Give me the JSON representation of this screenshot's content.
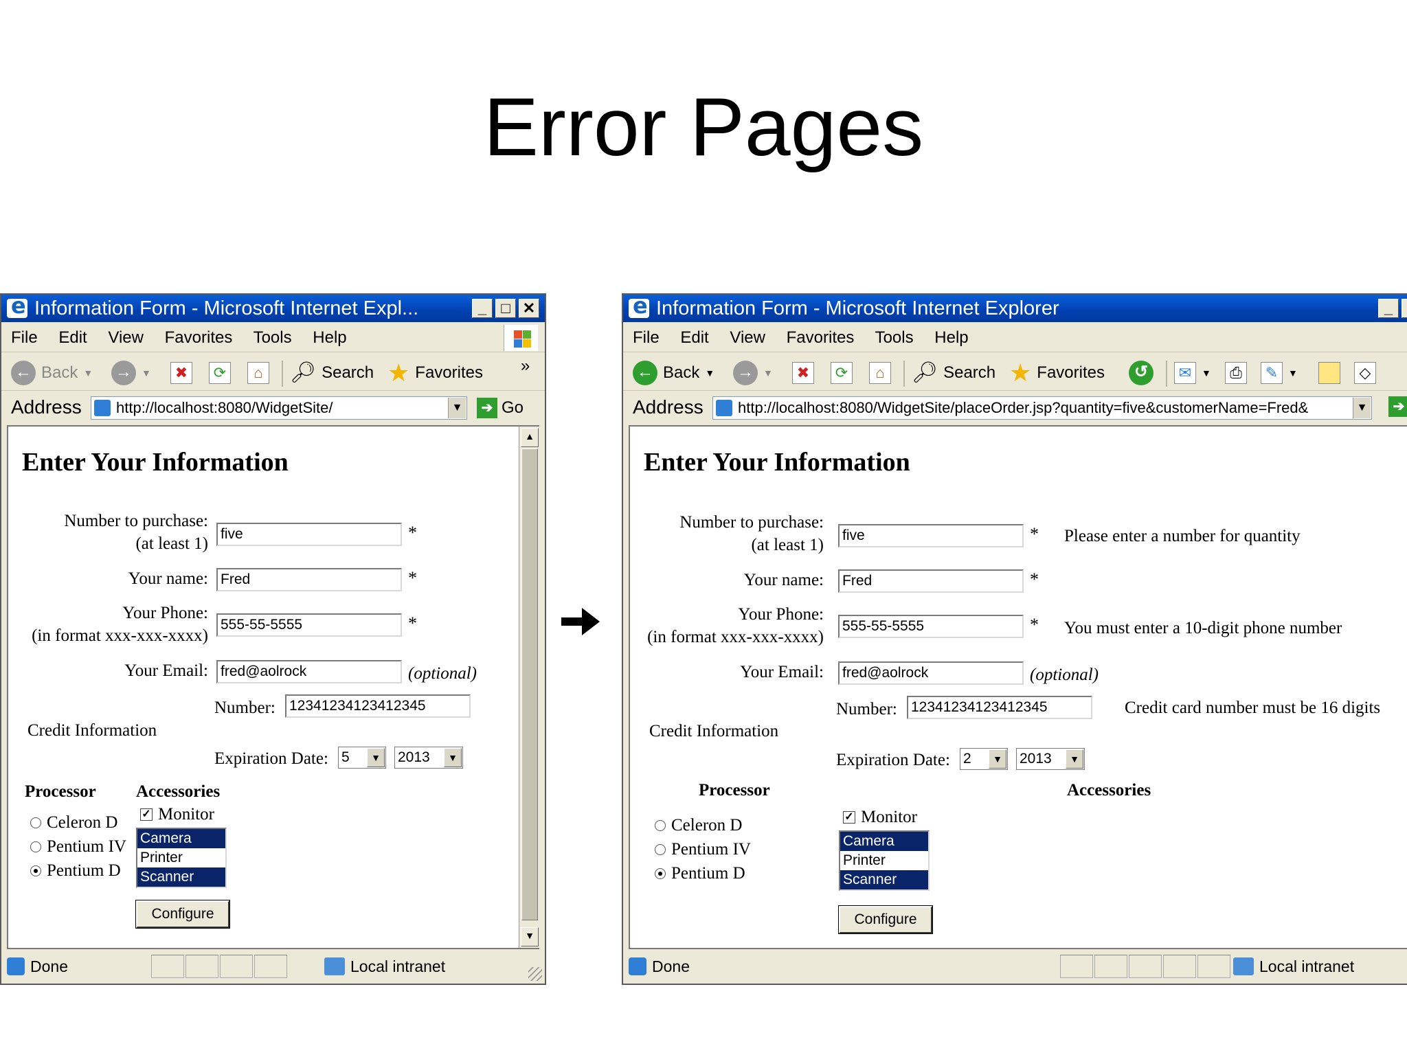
{
  "slide": {
    "title": "Error Pages"
  },
  "left_window": {
    "title": "Information Form - Microsoft Internet Expl...",
    "menu": [
      "File",
      "Edit",
      "View",
      "Favorites",
      "Tools",
      "Help"
    ],
    "toolbar": {
      "back": "Back",
      "search": "Search",
      "favorites": "Favorites",
      "more": "»"
    },
    "address": {
      "label": "Address",
      "url": "http://localhost:8080/WidgetSite/",
      "go": "Go"
    },
    "form": {
      "heading": "Enter Your Information",
      "number_label_1": "Number to purchase:",
      "number_label_2": "(at least 1)",
      "number_value": "five",
      "name_label": "Your name:",
      "name_value": "Fred",
      "phone_label_1": "Your Phone:",
      "phone_label_2": "(in format xxx-xxx-xxxx)",
      "phone_value": "555-55-5555",
      "email_label": "Your Email:",
      "email_value": "fred@aolrock",
      "optional": "(optional)",
      "required_mark": "*",
      "credit_label": "Credit Information",
      "card_number_label": "Number:",
      "card_number_value": "12341234123412345",
      "expiration_label": "Expiration Date:",
      "exp_month": "5",
      "exp_year": "2013",
      "processor_label": "Processor",
      "accessories_label": "Accessories",
      "processors": [
        "Celeron D",
        "Pentium IV",
        "Pentium D"
      ],
      "processor_selected": "Pentium D",
      "monitor_label": "Monitor",
      "list_items": [
        "Camera",
        "Printer",
        "Scanner"
      ],
      "configure": "Configure"
    },
    "status": {
      "done": "Done",
      "zone": "Local intranet"
    }
  },
  "right_window": {
    "title": "Information Form - Microsoft Internet Explorer",
    "menu": [
      "File",
      "Edit",
      "View",
      "Favorites",
      "Tools",
      "Help"
    ],
    "toolbar": {
      "back": "Back",
      "search": "Search",
      "favorites": "Favorites"
    },
    "address": {
      "label": "Address",
      "url": "http://localhost:8080/WidgetSite/placeOrder.jsp?quantity=five&customerName=Fred&"
    },
    "form": {
      "heading": "Enter Your Information",
      "number_label_1": "Number to purchase:",
      "number_label_2": "(at least 1)",
      "number_value": "five",
      "number_error": "Please enter a number for quantity",
      "name_label": "Your name:",
      "name_value": "Fred",
      "phone_label_1": "Your Phone:",
      "phone_label_2": "(in format xxx-xxx-xxxx)",
      "phone_value": "555-55-5555",
      "phone_error": "You must enter a 10-digit phone number",
      "email_label": "Your Email:",
      "email_value": "fred@aolrock",
      "optional": "(optional)",
      "required_mark": "*",
      "credit_label": "Credit Information",
      "card_number_label": "Number:",
      "card_number_value": "12341234123412345",
      "card_error": "Credit card number must be 16 digits",
      "expiration_label": "Expiration Date:",
      "exp_month": "2",
      "exp_year": "2013",
      "processor_label": "Processor",
      "accessories_label": "Accessories",
      "processors": [
        "Celeron D",
        "Pentium IV",
        "Pentium D"
      ],
      "processor_selected": "Pentium D",
      "monitor_label": "Monitor",
      "list_items": [
        "Camera",
        "Printer",
        "Scanner"
      ],
      "configure": "Configure"
    },
    "status": {
      "done": "Done",
      "zone": "Local intranet"
    }
  },
  "colors": {
    "titlebar": "#0040b0",
    "list_selection": "#0a246a",
    "window_chrome": "#ece9d8"
  }
}
